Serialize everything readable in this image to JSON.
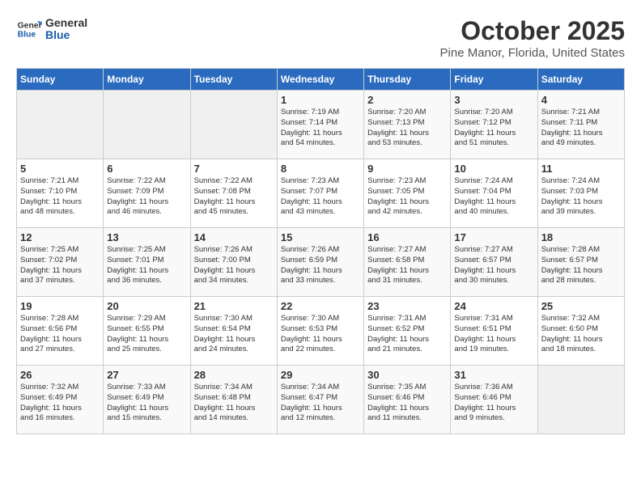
{
  "logo": {
    "line1": "General",
    "line2": "Blue"
  },
  "title": "October 2025",
  "location": "Pine Manor, Florida, United States",
  "days_of_week": [
    "Sunday",
    "Monday",
    "Tuesday",
    "Wednesday",
    "Thursday",
    "Friday",
    "Saturday"
  ],
  "weeks": [
    [
      {
        "day": "",
        "info": ""
      },
      {
        "day": "",
        "info": ""
      },
      {
        "day": "",
        "info": ""
      },
      {
        "day": "1",
        "info": "Sunrise: 7:19 AM\nSunset: 7:14 PM\nDaylight: 11 hours\nand 54 minutes."
      },
      {
        "day": "2",
        "info": "Sunrise: 7:20 AM\nSunset: 7:13 PM\nDaylight: 11 hours\nand 53 minutes."
      },
      {
        "day": "3",
        "info": "Sunrise: 7:20 AM\nSunset: 7:12 PM\nDaylight: 11 hours\nand 51 minutes."
      },
      {
        "day": "4",
        "info": "Sunrise: 7:21 AM\nSunset: 7:11 PM\nDaylight: 11 hours\nand 49 minutes."
      }
    ],
    [
      {
        "day": "5",
        "info": "Sunrise: 7:21 AM\nSunset: 7:10 PM\nDaylight: 11 hours\nand 48 minutes."
      },
      {
        "day": "6",
        "info": "Sunrise: 7:22 AM\nSunset: 7:09 PM\nDaylight: 11 hours\nand 46 minutes."
      },
      {
        "day": "7",
        "info": "Sunrise: 7:22 AM\nSunset: 7:08 PM\nDaylight: 11 hours\nand 45 minutes."
      },
      {
        "day": "8",
        "info": "Sunrise: 7:23 AM\nSunset: 7:07 PM\nDaylight: 11 hours\nand 43 minutes."
      },
      {
        "day": "9",
        "info": "Sunrise: 7:23 AM\nSunset: 7:05 PM\nDaylight: 11 hours\nand 42 minutes."
      },
      {
        "day": "10",
        "info": "Sunrise: 7:24 AM\nSunset: 7:04 PM\nDaylight: 11 hours\nand 40 minutes."
      },
      {
        "day": "11",
        "info": "Sunrise: 7:24 AM\nSunset: 7:03 PM\nDaylight: 11 hours\nand 39 minutes."
      }
    ],
    [
      {
        "day": "12",
        "info": "Sunrise: 7:25 AM\nSunset: 7:02 PM\nDaylight: 11 hours\nand 37 minutes."
      },
      {
        "day": "13",
        "info": "Sunrise: 7:25 AM\nSunset: 7:01 PM\nDaylight: 11 hours\nand 36 minutes."
      },
      {
        "day": "14",
        "info": "Sunrise: 7:26 AM\nSunset: 7:00 PM\nDaylight: 11 hours\nand 34 minutes."
      },
      {
        "day": "15",
        "info": "Sunrise: 7:26 AM\nSunset: 6:59 PM\nDaylight: 11 hours\nand 33 minutes."
      },
      {
        "day": "16",
        "info": "Sunrise: 7:27 AM\nSunset: 6:58 PM\nDaylight: 11 hours\nand 31 minutes."
      },
      {
        "day": "17",
        "info": "Sunrise: 7:27 AM\nSunset: 6:57 PM\nDaylight: 11 hours\nand 30 minutes."
      },
      {
        "day": "18",
        "info": "Sunrise: 7:28 AM\nSunset: 6:57 PM\nDaylight: 11 hours\nand 28 minutes."
      }
    ],
    [
      {
        "day": "19",
        "info": "Sunrise: 7:28 AM\nSunset: 6:56 PM\nDaylight: 11 hours\nand 27 minutes."
      },
      {
        "day": "20",
        "info": "Sunrise: 7:29 AM\nSunset: 6:55 PM\nDaylight: 11 hours\nand 25 minutes."
      },
      {
        "day": "21",
        "info": "Sunrise: 7:30 AM\nSunset: 6:54 PM\nDaylight: 11 hours\nand 24 minutes."
      },
      {
        "day": "22",
        "info": "Sunrise: 7:30 AM\nSunset: 6:53 PM\nDaylight: 11 hours\nand 22 minutes."
      },
      {
        "day": "23",
        "info": "Sunrise: 7:31 AM\nSunset: 6:52 PM\nDaylight: 11 hours\nand 21 minutes."
      },
      {
        "day": "24",
        "info": "Sunrise: 7:31 AM\nSunset: 6:51 PM\nDaylight: 11 hours\nand 19 minutes."
      },
      {
        "day": "25",
        "info": "Sunrise: 7:32 AM\nSunset: 6:50 PM\nDaylight: 11 hours\nand 18 minutes."
      }
    ],
    [
      {
        "day": "26",
        "info": "Sunrise: 7:32 AM\nSunset: 6:49 PM\nDaylight: 11 hours\nand 16 minutes."
      },
      {
        "day": "27",
        "info": "Sunrise: 7:33 AM\nSunset: 6:49 PM\nDaylight: 11 hours\nand 15 minutes."
      },
      {
        "day": "28",
        "info": "Sunrise: 7:34 AM\nSunset: 6:48 PM\nDaylight: 11 hours\nand 14 minutes."
      },
      {
        "day": "29",
        "info": "Sunrise: 7:34 AM\nSunset: 6:47 PM\nDaylight: 11 hours\nand 12 minutes."
      },
      {
        "day": "30",
        "info": "Sunrise: 7:35 AM\nSunset: 6:46 PM\nDaylight: 11 hours\nand 11 minutes."
      },
      {
        "day": "31",
        "info": "Sunrise: 7:36 AM\nSunset: 6:46 PM\nDaylight: 11 hours\nand 9 minutes."
      },
      {
        "day": "",
        "info": ""
      }
    ]
  ]
}
